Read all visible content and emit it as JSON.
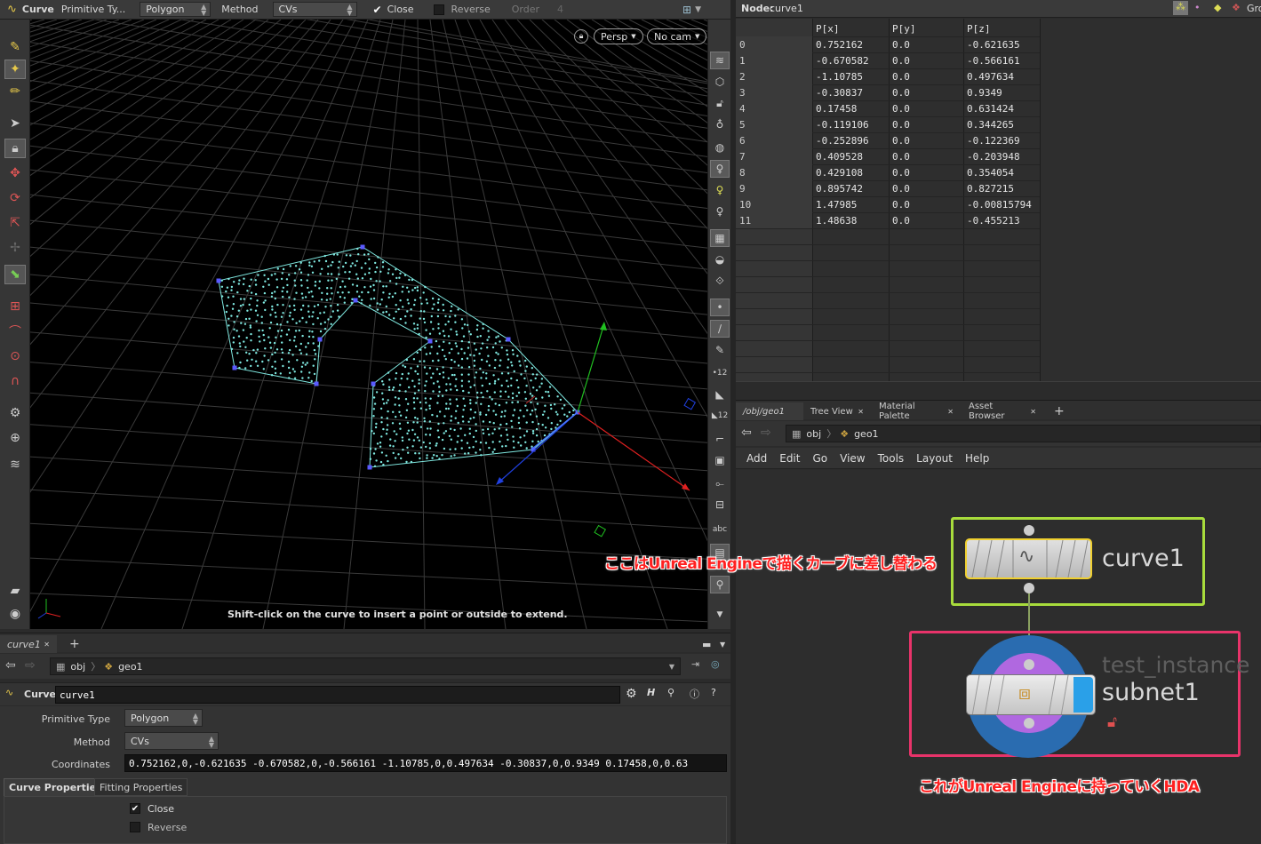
{
  "toolbar": {
    "tool_name": "Curve",
    "primitive_type_label": "Primitive Ty...",
    "primitive_type_value": "Polygon",
    "method_label": "Method",
    "method_value": "CVs",
    "close_label": "Close",
    "reverse_label": "Reverse",
    "order_label": "Order",
    "order_value": "4"
  },
  "viewport": {
    "persp_label": "Persp",
    "cam_label": "No cam",
    "hint": "Shift-click on the curve to insert a point or outside to extend."
  },
  "right_tools": {
    "text_tool_label": "abc"
  },
  "param_pane": {
    "tab_label": "curve1",
    "path_obj": "obj",
    "path_geo": "geo1",
    "node_type": "Curve",
    "node_name": "curve1",
    "primitive_type_label": "Primitive Type",
    "primitive_type_value": "Polygon",
    "method_label": "Method",
    "method_value": "CVs",
    "coords_label": "Coordinates",
    "coords_value": "0.752162,0,-0.621635 -0.670582,0,-0.566161 -1.10785,0,0.497634 -0.30837,0,0.9349 0.17458,0,0.63",
    "tabs": [
      "Curve Properties",
      "Fitting Properties"
    ],
    "close_label": "Close",
    "reverse_label": "Reverse"
  },
  "spreadsheet": {
    "node_label": "Node:",
    "node_name": "curve1",
    "gro_label": "Gro",
    "headers": [
      "",
      "P[x]",
      "P[y]",
      "P[z]"
    ],
    "rows": [
      [
        "0",
        "0.752162",
        "0.0",
        "-0.621635"
      ],
      [
        "1",
        "-0.670582",
        "0.0",
        "-0.566161"
      ],
      [
        "2",
        "-1.10785",
        "0.0",
        "0.497634"
      ],
      [
        "3",
        "-0.30837",
        "0.0",
        "0.9349"
      ],
      [
        "4",
        "0.17458",
        "0.0",
        "0.631424"
      ],
      [
        "5",
        "-0.119106",
        "0.0",
        "0.344265"
      ],
      [
        "6",
        "-0.252896",
        "0.0",
        "-0.122369"
      ],
      [
        "7",
        "0.409528",
        "0.0",
        "-0.203948"
      ],
      [
        "8",
        "0.429108",
        "0.0",
        "0.354054"
      ],
      [
        "9",
        "0.895742",
        "0.0",
        "0.827215"
      ],
      [
        "10",
        "1.47985",
        "0.0",
        "-0.00815794"
      ],
      [
        "11",
        "1.48638",
        "0.0",
        "-0.455213"
      ]
    ]
  },
  "network": {
    "tabs": [
      "/obj/geo1",
      "Tree View",
      "Material Palette",
      "Asset Browser"
    ],
    "path_obj": "obj",
    "path_geo": "geo1",
    "menu": [
      "Add",
      "Edit",
      "Go",
      "View",
      "Tools",
      "Layout",
      "Help"
    ],
    "curve_node_name": "curve1",
    "subnet_type": "test_instance",
    "subnet_name": "subnet1",
    "annotation_curve": "ここはUnreal Engineで描くカーブに差し替わる",
    "annotation_hda": "これがUnreal Engineに持っていくHDA"
  },
  "colors": {
    "curve_box": "#a8dc3c",
    "hda_box": "#e8336a",
    "annotation": "#ff2020",
    "points": "#7fe8e0"
  }
}
